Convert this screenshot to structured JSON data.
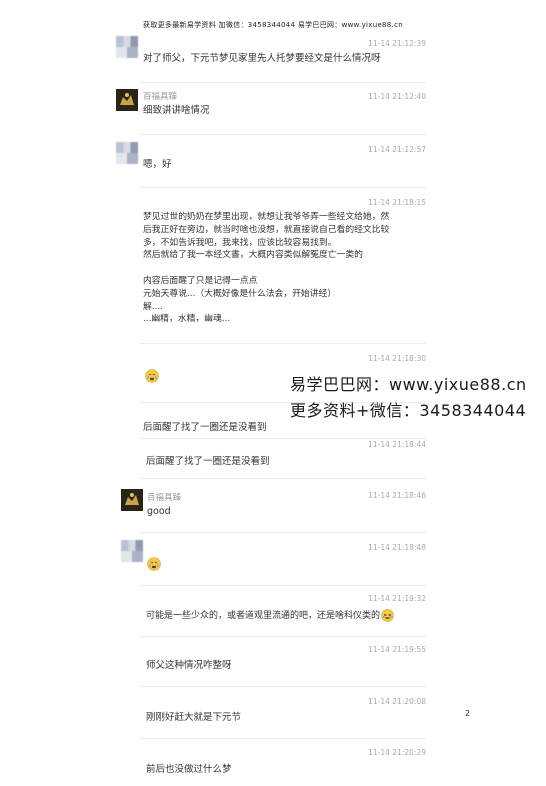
{
  "header": "获取更多最新易学资料 加微信：3458344044 易学巴巴网：www.yixue88.cn",
  "messages": [
    {
      "time": "11-14 21:12:39",
      "text": "对了师父，下元节梦见家里先人托梦要经文是什么情况呀"
    },
    {
      "name": "百福具臻",
      "time": "11-14 21:12:40",
      "text": "细致讲讲啥情况"
    },
    {
      "time": "11-14 21:12:57",
      "text": "嗯，好"
    },
    {
      "time": "11-14 21:18:15",
      "text": "梦见过世的奶奶在梦里出现，就想让我爷爷弄一些经文给她，然\n后我正好在旁边，就当时啥也没想，就直接说自己看的经文比较\n多，不如告诉我吧，我来找，应该比较容易找到。\n然后就给了我一本经文書，大概内容类似解冤度亡一类的\n\n内容后面醒了只是记得一点点\n元始天尊说...（大概好像是什么法会，开始讲经）\n解....\n...幽精，水精，幽魂..."
    },
    {
      "time": "11-14 21:18:30",
      "text": ""
    },
    {
      "time": "",
      "text": "后面醒了找了一圈还是没看到"
    },
    {
      "time": "11-14 21:18:44",
      "text": "后面醒了找了一圈还是没看到"
    },
    {
      "name": "百福具臻",
      "time": "11-14 21:18:46",
      "text": "good"
    },
    {
      "time": "11-14 21:18:48",
      "text": ""
    },
    {
      "time": "11-14 21:19:32",
      "text": "可能是一些少众的，或者道观里流通的吧，还是啥科仪类的"
    },
    {
      "time": "11-14 21:19:55",
      "text": "师父这种情况咋整呀"
    },
    {
      "time": "11-14 21:20:08",
      "text": "刚刚好赶大就是下元节"
    },
    {
      "time": "11-14 21:20:29",
      "text": "前后也没做过什么梦"
    }
  ],
  "watermark": {
    "line1": "易学巴巴网：www.yixue88.cn",
    "line2": "更多资料+微信：3458344044"
  },
  "page_number": "2",
  "icons": {
    "emoji_cry": "crying-face-icon",
    "emoji_laugh": "laughing-tears-icon"
  }
}
